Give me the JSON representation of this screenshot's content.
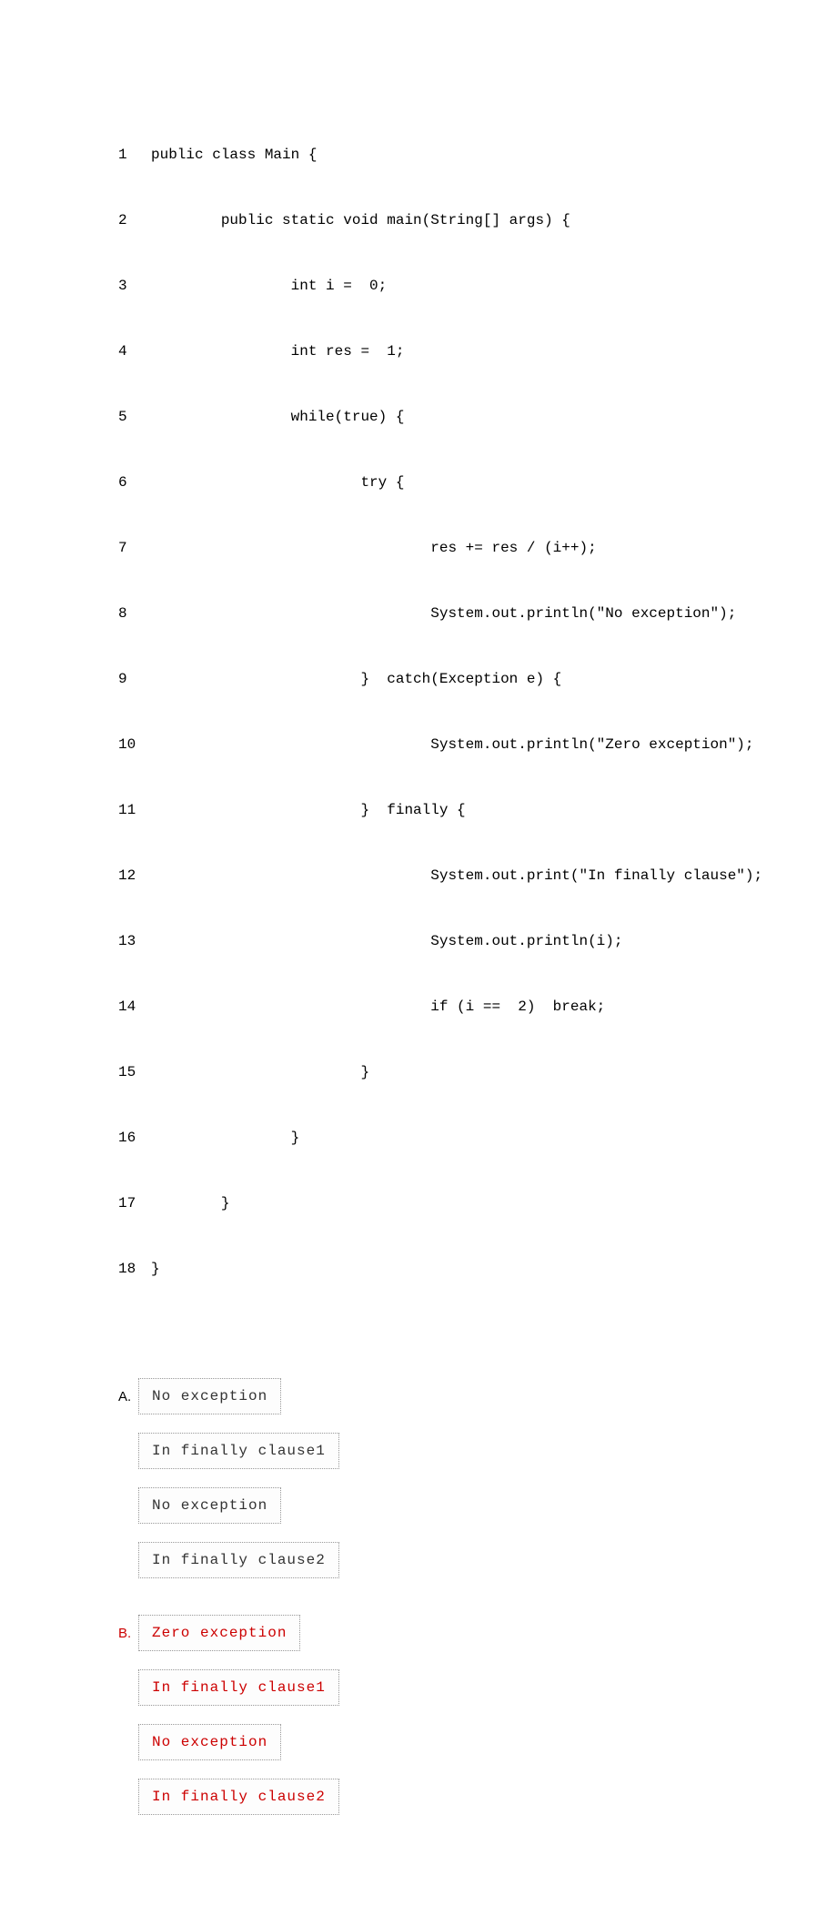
{
  "code": {
    "lines": [
      {
        "n": "1",
        "t": "public class Main {"
      },
      {
        "n": "2",
        "t": "        public static void main(String[] args) {"
      },
      {
        "n": "3",
        "t": "                int i =  0;"
      },
      {
        "n": "4",
        "t": "                int res =  1;"
      },
      {
        "n": "5",
        "t": "                while(true) {"
      },
      {
        "n": "6",
        "t": "                        try {"
      },
      {
        "n": "7",
        "t": "                                res += res / (i++);"
      },
      {
        "n": "8",
        "t": "                                System.out.println(\"No exception\");"
      },
      {
        "n": "9",
        "t": "                        }  catch(Exception e) {"
      },
      {
        "n": "10",
        "t": "                                System.out.println(\"Zero exception\");"
      },
      {
        "n": "11",
        "t": "                        }  finally {"
      },
      {
        "n": "12",
        "t": "                                System.out.print(\"In finally clause\");"
      },
      {
        "n": "13",
        "t": "                                System.out.println(i);"
      },
      {
        "n": "14",
        "t": "                                if (i ==  2)  break;"
      },
      {
        "n": "15",
        "t": "                        }"
      },
      {
        "n": "16",
        "t": "                }"
      },
      {
        "n": "17",
        "t": "        }"
      },
      {
        "n": "18",
        "t": "}"
      }
    ]
  },
  "options": {
    "A": {
      "label": "A.",
      "lines": [
        "No exception",
        "In finally clause1",
        "No exception",
        "In finally clause2"
      ]
    },
    "B": {
      "label": "B.",
      "lines": [
        "Zero exception",
        "In finally clause1",
        "No exception",
        "In finally clause2"
      ]
    }
  }
}
